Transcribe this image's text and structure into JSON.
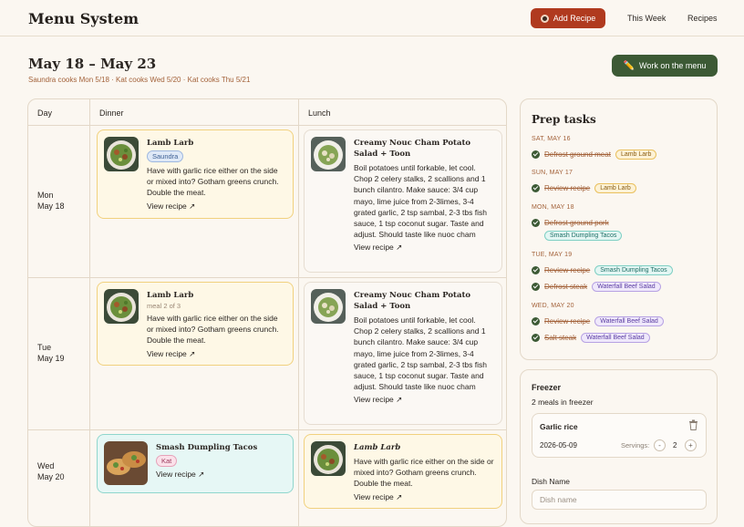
{
  "header": {
    "app_title": "Menu System",
    "add_recipe_label": "Add Recipe",
    "nav": [
      "This Week",
      "Recipes"
    ]
  },
  "week": {
    "title": "May 18 – May 23",
    "subtitle": "Saundra cooks Mon 5/18 · Kat cooks Wed 5/20 · Kat cooks Thu 5/21",
    "work_button": "Work on the menu"
  },
  "table": {
    "columns": [
      "Day",
      "Dinner",
      "Lunch"
    ],
    "rows": [
      {
        "day": "Mon",
        "date": "May 18",
        "dinner": {
          "title": "Lamb Larb",
          "tag": "Saundra",
          "desc": "Have with garlic rice either on the side or mixed into? Gotham greens crunch. Double the meat.",
          "link": "View recipe ↗"
        },
        "lunch": {
          "title": "Creamy Nouc Cham Potato Salad + Toon",
          "desc": "Boil potatoes until forkable, let cool. Chop 2 celery stalks, 2 scallions and 1 bunch cilantro. Make sauce: 3/4 cup mayo, lime juice from 2-3limes, 3-4 grated garlic, 2 tsp sambal, 2-3 tbs fish sauce, 1 tsp coconut sugar. Taste and adjust. Should taste like nuoc cham",
          "link": "View recipe ↗"
        }
      },
      {
        "day": "Tue",
        "date": "May 19",
        "dinner": {
          "title": "Lamb Larb",
          "meal_of": "meal 2 of 3",
          "desc": "Have with garlic rice either on the side or mixed into? Gotham greens crunch. Double the meat.",
          "link": "View recipe ↗"
        },
        "lunch": {
          "title": "Creamy Nouc Cham Potato Salad + Toon",
          "desc": "Boil potatoes until forkable, let cool. Chop 2 celery stalks, 2 scallions and 1 bunch cilantro. Make sauce: 3/4 cup mayo, lime juice from 2-3limes, 3-4 grated garlic, 2 tsp sambal, 2-3 tbs fish sauce, 1 tsp coconut sugar. Taste and adjust. Should taste like nuoc cham",
          "link": "View recipe ↗"
        }
      },
      {
        "day": "Wed",
        "date": "May 20",
        "dinner": {
          "title": "Smash Dumpling Tacos",
          "tag": "Kat",
          "link": "View recipe ↗"
        },
        "lunch": {
          "title": "Lamb Larb",
          "desc": "Have with garlic rice either on the side or mixed into? Gotham greens crunch. Double the meat.",
          "link": "View recipe ↗"
        }
      }
    ]
  },
  "prep": {
    "title": "Prep tasks",
    "groups": [
      {
        "date": "SAT, MAY 16",
        "tasks": [
          {
            "name": "Defrost ground meat",
            "tag": "Lamb Larb"
          }
        ]
      },
      {
        "date": "SUN, MAY 17",
        "tasks": [
          {
            "name": "Review recipe",
            "tag": "Lamb Larb"
          }
        ]
      },
      {
        "date": "MON, MAY 18",
        "tasks": [
          {
            "name": "Defrost ground pork",
            "tag": "Smash Dumpling Tacos"
          }
        ]
      },
      {
        "date": "TUE, MAY 19",
        "tasks": [
          {
            "name": "Review recipe",
            "tag": "Smash Dumpling Tacos"
          },
          {
            "name": "Defrost steak",
            "tag": "Waterfall Beef Salad"
          }
        ]
      },
      {
        "date": "WED, MAY 20",
        "tasks": [
          {
            "name": "Review recipe",
            "tag": "Waterfall Beef Salad"
          },
          {
            "name": "Salt steak",
            "tag": "Waterfall Beef Salad"
          }
        ]
      }
    ]
  },
  "freezer": {
    "title": "Freezer",
    "count": "2 meals in freezer",
    "item": {
      "name": "Garlic rice",
      "date": "2026-05-09",
      "servings_label": "Servings:",
      "servings": "2"
    },
    "dish_label": "Dish Name",
    "dish_placeholder": "Dish name"
  },
  "colors": {
    "accent_red": "#b03a1f",
    "accent_green": "#3c5a35",
    "muted_brown": "#a3623a",
    "background": "#fbf7f1"
  }
}
